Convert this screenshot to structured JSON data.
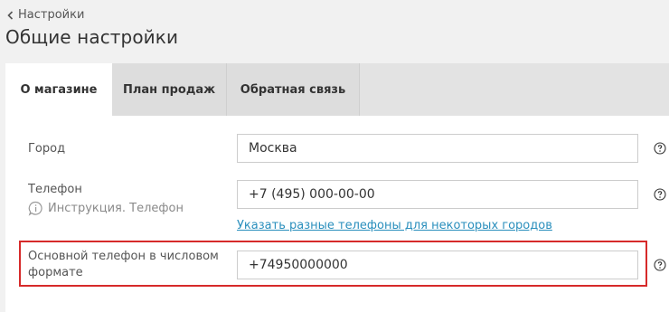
{
  "header": {
    "back_label": "Настройки",
    "title": "Общие настройки"
  },
  "tabs": [
    {
      "label": "О магазине",
      "active": true
    },
    {
      "label": "План продаж",
      "active": false
    },
    {
      "label": "Обратная связь",
      "active": false
    }
  ],
  "form": {
    "city": {
      "label": "Город",
      "value": "Москва"
    },
    "phone": {
      "label": "Телефон",
      "hint": "Инструкция. Телефон",
      "value": "+7 (495) 000-00-00",
      "link": "Указать разные телефоны для некоторых городов"
    },
    "phone_numeric": {
      "label_line1": "Основной телефон в числовом",
      "label_line2": "формате",
      "value": "+74950000000"
    }
  },
  "colors": {
    "accent_link": "#2a8fbd",
    "highlight": "#d62a2a",
    "background": "#f1f1f1"
  }
}
